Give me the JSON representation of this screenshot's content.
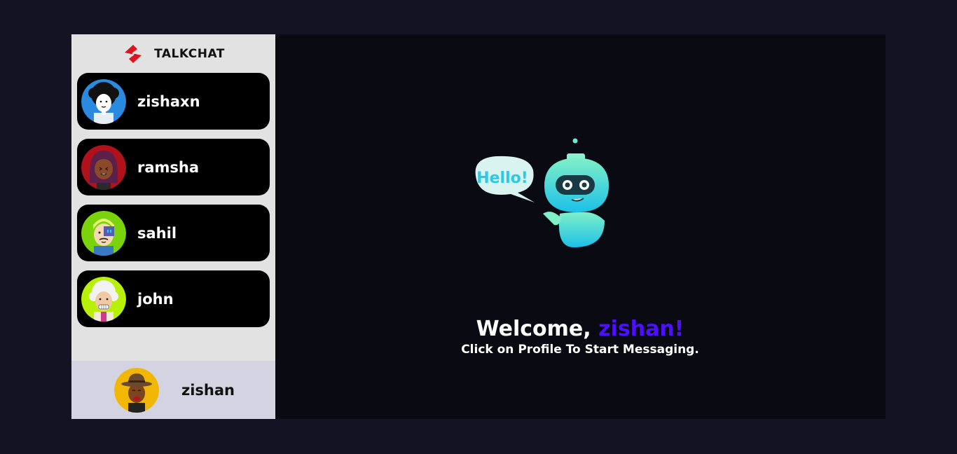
{
  "brand": {
    "name": "TALKCHAT",
    "logo_icon": "talkchat-logo-icon",
    "logo_color": "#e0141e"
  },
  "contacts": [
    {
      "name": "zishaxn",
      "avatar": "curly-hair-avatar"
    },
    {
      "name": "ramsha",
      "avatar": "woman-avatar"
    },
    {
      "name": "sahil",
      "avatar": "cyborg-avatar"
    },
    {
      "name": "john",
      "avatar": "old-man-avatar"
    }
  ],
  "current_user": {
    "name": "zishan",
    "avatar": "hat-man-avatar"
  },
  "welcome": {
    "greeting": "Welcome,",
    "username": "zishan!",
    "subtitle": "Click on Profile To Start Messaging.",
    "bubble_text": "Hello!",
    "accent": "#4e0eff"
  }
}
